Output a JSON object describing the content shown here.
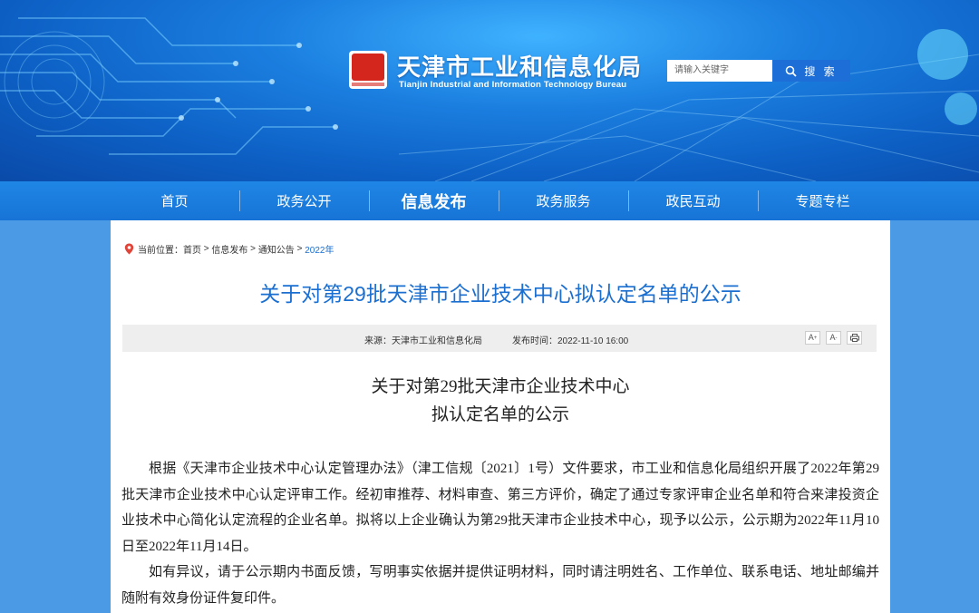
{
  "header": {
    "site_title": "天津市工业和信息化局",
    "site_subtitle": "Tianjin Industrial and Information Technology Bureau",
    "search_placeholder": "请输入关键字",
    "search_button": "搜 索"
  },
  "nav": {
    "items": [
      {
        "label": "首页"
      },
      {
        "label": "政务公开"
      },
      {
        "label": "信息发布",
        "active": true
      },
      {
        "label": "政务服务"
      },
      {
        "label": "政民互动"
      },
      {
        "label": "专题专栏"
      }
    ]
  },
  "breadcrumb": {
    "prefix": "当前位置：",
    "items": [
      "首页",
      "信息发布",
      "通知公告",
      "2022年"
    ],
    "sep": " > "
  },
  "article": {
    "title": "关于对第29批天津市企业技术中心拟认定名单的公示",
    "source": "来源：天津市工业和信息化局",
    "time": "发布时间：2022-11-10 16:00",
    "tools": [
      "A+",
      "A-",
      "print"
    ],
    "doc_title_line1": "关于对第29批天津市企业技术中心",
    "doc_title_line2": "拟认定名单的公示",
    "paragraphs": [
      "根据《天津市企业技术中心认定管理办法》（津工信规〔2021〕1号）文件要求，市工业和信息化局组织开展了2022年第29批天津市企业技术中心认定评审工作。经初审推荐、材料审查、第三方评价，确定了通过专家评审企业名单和符合来津投资企业技术中心简化认定流程的企业名单。拟将以上企业确认为第29批天津市企业技术中心，现予以公示，公示期为2022年11月10日至2022年11月14日。",
      "如有异议，请于公示期内书面反馈，写明事实依据并提供证明材料，同时请注明姓名、工作单位、联系电话、地址邮编并随附有效身份证件复印件。"
    ]
  },
  "colors": {
    "accent": "#1b6fd0",
    "nav_bg": "#1774d6",
    "page_bg": "#4a9ae6"
  }
}
